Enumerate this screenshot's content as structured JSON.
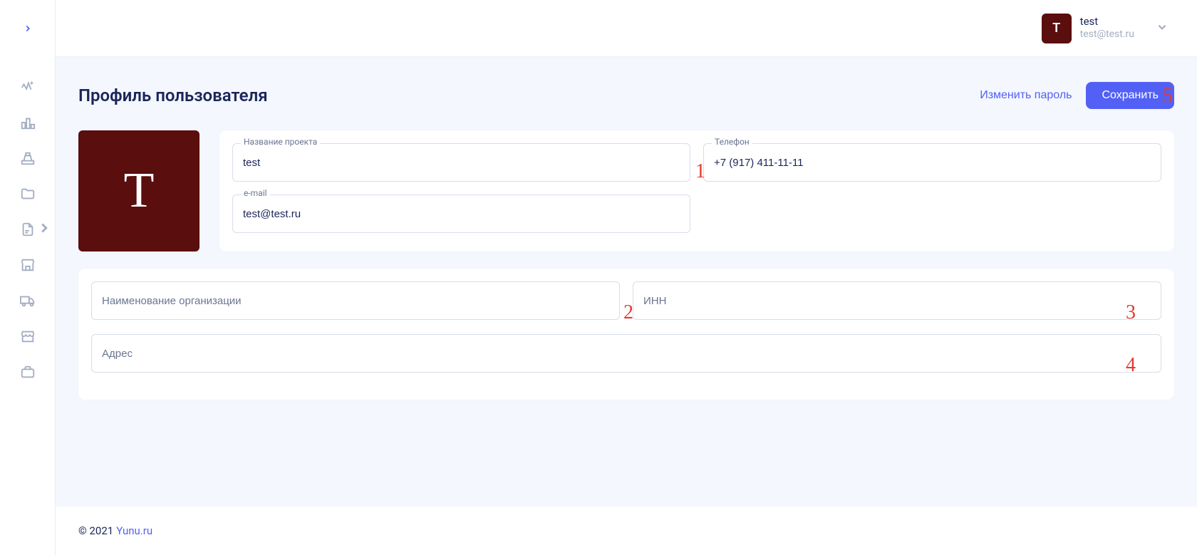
{
  "user": {
    "initial": "T",
    "name": "test",
    "email": "test@test.ru"
  },
  "page": {
    "title": "Профиль пользователя"
  },
  "actions": {
    "change_password": "Изменить пароль",
    "save": "Сохранить"
  },
  "avatar": {
    "initial": "T"
  },
  "fields": {
    "project_name": {
      "label": "Название проекта",
      "value": "test"
    },
    "phone": {
      "label": "Телефон",
      "value": "+7 (917) 411-11-11"
    },
    "email": {
      "label": "e-mail",
      "value": "test@test.ru"
    },
    "org_name": {
      "placeholder": "Наименование организации",
      "value": ""
    },
    "inn": {
      "placeholder": "ИНН",
      "value": ""
    },
    "address": {
      "placeholder": "Адрес",
      "value": ""
    }
  },
  "annotations": {
    "a1": "1",
    "a2": "2",
    "a3": "3",
    "a4": "4",
    "a5": "5"
  },
  "footer": {
    "prefix": "© 2021",
    "brand": "Yunu.ru"
  }
}
